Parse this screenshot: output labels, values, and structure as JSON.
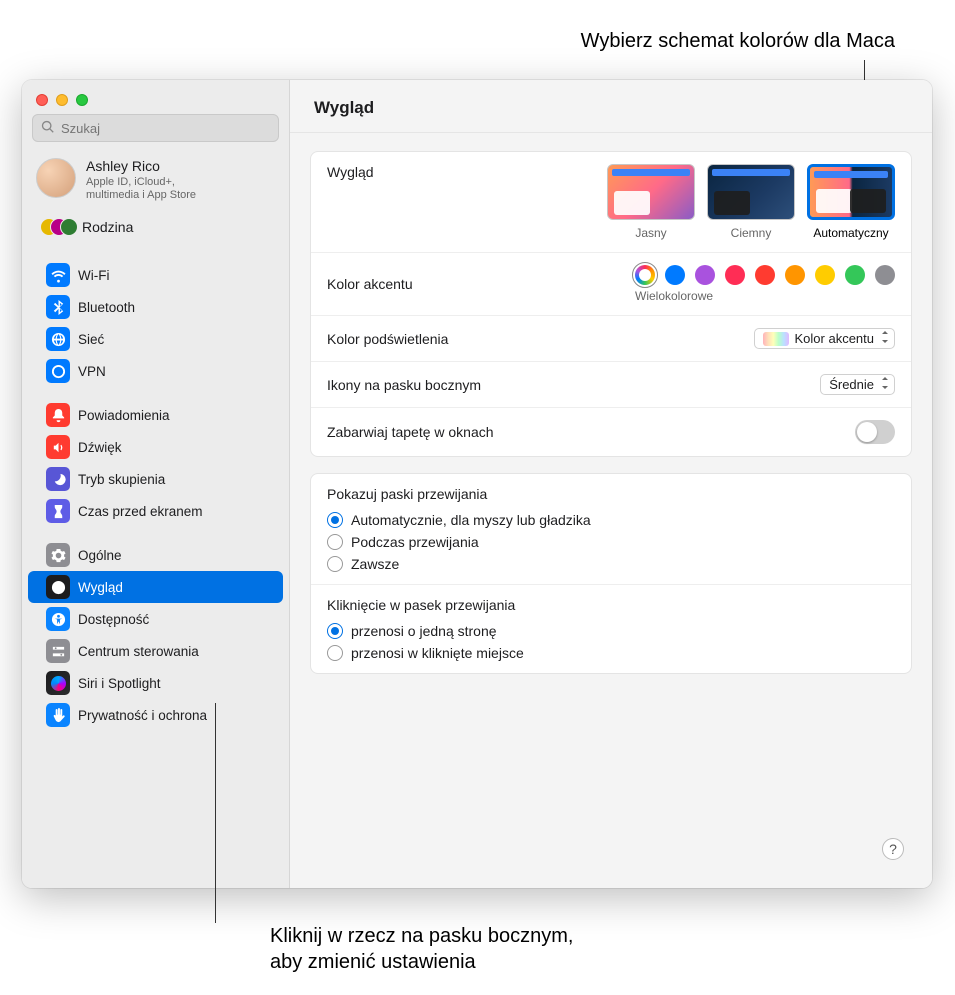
{
  "callouts": {
    "top": "Wybierz schemat kolorów dla Maca",
    "bottom_l1": "Kliknij w rzecz na pasku bocznym,",
    "bottom_l2": "aby zmienić ustawienia"
  },
  "search": {
    "placeholder": "Szukaj"
  },
  "account": {
    "name": "Ashley Rico",
    "sub1": "Apple ID, iCloud+,",
    "sub2": "multimedia i App Store"
  },
  "family_label": "Rodzina",
  "sidebar": {
    "items": [
      {
        "label": "Wi-Fi"
      },
      {
        "label": "Bluetooth"
      },
      {
        "label": "Sieć"
      },
      {
        "label": "VPN"
      },
      {
        "label": "Powiadomienia"
      },
      {
        "label": "Dźwięk"
      },
      {
        "label": "Tryb skupienia"
      },
      {
        "label": "Czas przed ekranem"
      },
      {
        "label": "Ogólne"
      },
      {
        "label": "Wygląd"
      },
      {
        "label": "Dostępność"
      },
      {
        "label": "Centrum sterowania"
      },
      {
        "label": "Siri i Spotlight"
      },
      {
        "label": "Prywatność i ochrona"
      }
    ]
  },
  "header": "Wygląd",
  "appearance": {
    "label": "Wygląd",
    "options": {
      "light": "Jasny",
      "dark": "Ciemny",
      "auto": "Automatyczny"
    }
  },
  "accent": {
    "label": "Kolor akcentu",
    "selected_label": "Wielokolorowe",
    "colors": [
      "#007aff",
      "#a952de",
      "#ff2d55",
      "#ff3b30",
      "#ff9500",
      "#ffcc00",
      "#34c759",
      "#8e8e93"
    ]
  },
  "highlight": {
    "label": "Kolor podświetlenia",
    "value": "Kolor akcentu"
  },
  "sidebar_icons": {
    "label": "Ikony na pasku bocznym",
    "value": "Średnie"
  },
  "tint": {
    "label": "Zabarwiaj tapetę w oknach"
  },
  "scrollbars": {
    "title": "Pokazuj paski przewijania",
    "opts": [
      "Automatycznie, dla myszy lub gładzika",
      "Podczas przewijania",
      "Zawsze"
    ]
  },
  "click_scroll": {
    "title": "Kliknięcie w pasek przewijania",
    "opts": [
      "przenosi o jedną stronę",
      "przenosi w kliknięte miejsce"
    ]
  },
  "help": "?"
}
